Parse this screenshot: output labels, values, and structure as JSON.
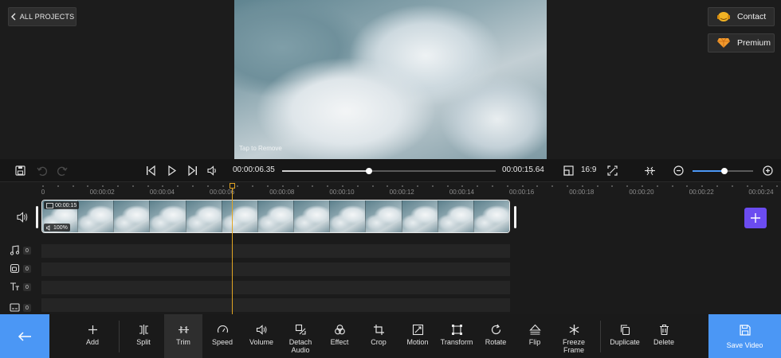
{
  "top": {
    "all_projects_label": "ALL PROJECTS",
    "watermark_text": "Tap to Remove",
    "contact_label": "Contact",
    "premium_label": "Premium"
  },
  "player": {
    "current_time": "00:00:06.35",
    "total_time": "00:00:15.64",
    "progress_fraction": 0.406,
    "aspect_ratio": "16:9",
    "zoom_fraction": 0.52
  },
  "timeline": {
    "ruler_labels": [
      "0",
      "00:00:02",
      "00:00:04",
      "00:00:06",
      "00:00:08",
      "00:00:10",
      "00:00:12",
      "00:00:14",
      "00:00:16",
      "00:00:18",
      "00:00:20",
      "00:00:22",
      "00:00:24"
    ],
    "clip_duration": "00:00:15",
    "clip_volume": "100%",
    "music_count": "0",
    "overlay_count": "0",
    "text_count": "0",
    "subtitle_count": "0"
  },
  "toolbar": {
    "add": "Add",
    "split": "Split",
    "trim": "Trim",
    "speed": "Speed",
    "volume": "Volume",
    "detach_audio_1": "Detach",
    "detach_audio_2": "Audio",
    "effect": "Effect",
    "crop": "Crop",
    "motion": "Motion",
    "transform": "Transform",
    "rotate": "Rotate",
    "flip": "Flip",
    "freeze_frame_1": "Freeze",
    "freeze_frame_2": "Frame",
    "duplicate": "Duplicate",
    "delete": "Delete",
    "save_video": "Save Video"
  },
  "colors": {
    "accent_blue": "#4b97f5",
    "playhead_orange": "#e0a424",
    "add_track_purple": "#6b4cf0"
  }
}
